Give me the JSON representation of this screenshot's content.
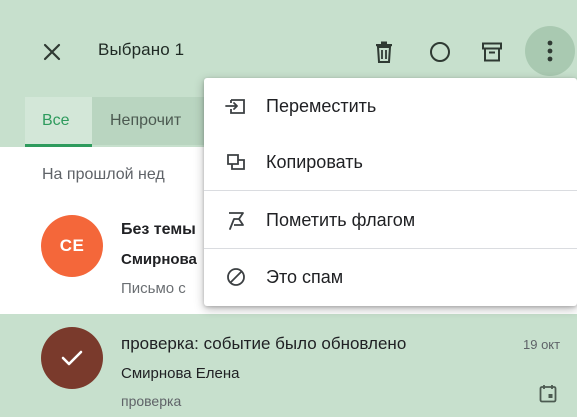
{
  "header": {
    "selection_title": "Выбрано 1"
  },
  "tabs": [
    {
      "label": "Все",
      "active": true
    },
    {
      "label": "Непрочит",
      "active": false
    }
  ],
  "list": {
    "section_label": "На прошлой нед",
    "messages": [
      {
        "avatar_initials": "СЕ",
        "avatar_color": "#f4673a",
        "subject": "Без темы",
        "sender": "Смирнова",
        "snippet": "Письмо с",
        "selected": false
      },
      {
        "subject": "проверка: событие было обновлено",
        "date": "19 окт",
        "sender": "Смирнова Елена",
        "snippet": "проверка",
        "selected": true,
        "avatar_color": "#7a3a2c"
      }
    ]
  },
  "menu": {
    "items": [
      {
        "label": "Переместить",
        "icon": "move-to-icon"
      },
      {
        "label": "Копировать",
        "icon": "copy-icon"
      },
      {
        "label": "Пометить флагом",
        "icon": "flag-icon"
      },
      {
        "label": "Это спам",
        "icon": "spam-icon"
      }
    ]
  },
  "colors": {
    "accent": "#2e9b5d",
    "selection_bg": "#c7e0cd",
    "avatar_orange": "#f4673a"
  }
}
